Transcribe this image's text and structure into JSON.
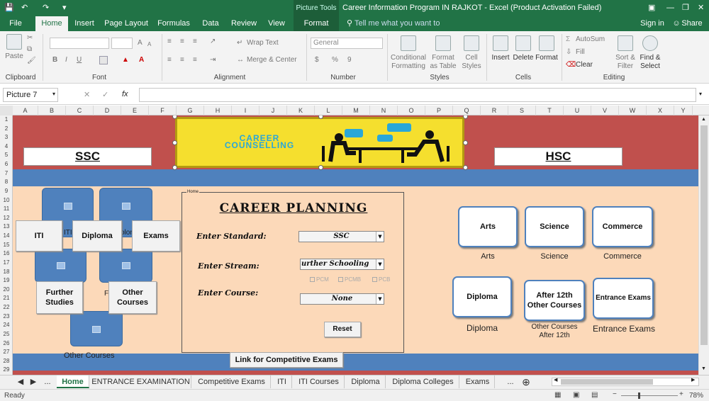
{
  "window": {
    "title": "Career Information Program  IN RAJKOT - Excel (Product Activation Failed)",
    "context_tab_group": "Picture Tools",
    "restore_icon": "restore-icon",
    "sign_in": "Sign in",
    "share": "Share"
  },
  "ribbon_tabs": [
    "File",
    "Home",
    "Insert",
    "Page Layout",
    "Formulas",
    "Data",
    "Review",
    "View",
    "Format"
  ],
  "tell_me": "Tell me what you want to do...",
  "ribbon": {
    "clipboard": {
      "paste": "Paste",
      "label": "Clipboard"
    },
    "font": {
      "label": "Font",
      "bold": "B",
      "italic": "I",
      "underline": "U",
      "grow": "A",
      "shrink": "A"
    },
    "alignment": {
      "wrap": "Wrap Text",
      "merge": "Merge & Center",
      "label": "Alignment"
    },
    "number": {
      "format": "General",
      "currency": "$",
      "percent": "%",
      "comma": "9",
      "label": "Number"
    },
    "styles": {
      "cond": "Conditional Formatting",
      "table": "Format as Table",
      "cell": "Cell Styles",
      "label": "Styles"
    },
    "cells": {
      "insert": "Insert",
      "delete": "Delete",
      "format": "Format",
      "label": "Cells"
    },
    "editing": {
      "autosum": "AutoSum",
      "fill": "Fill",
      "clear": "Clear",
      "sort": "Sort & Filter",
      "find": "Find & Select",
      "label": "Editing"
    }
  },
  "formula_bar": {
    "name_box": "Picture 7",
    "fx": "fx",
    "cancel": "✕",
    "enter": "✓",
    "value": ""
  },
  "columns": [
    "A",
    "B",
    "C",
    "D",
    "E",
    "F",
    "G",
    "H",
    "I",
    "J",
    "K",
    "L",
    "M",
    "N",
    "O",
    "P",
    "Q",
    "R",
    "S",
    "T",
    "U",
    "V",
    "W",
    "X",
    "Y"
  ],
  "rows": [
    "1",
    "2",
    "3",
    "4",
    "5",
    "6",
    "7",
    "8",
    "9",
    "10",
    "11",
    "12",
    "13",
    "14",
    "15",
    "16",
    "17",
    "18",
    "19",
    "20",
    "21",
    "22",
    "23",
    "24",
    "25",
    "26",
    "27",
    "28",
    "29"
  ],
  "sheet": {
    "ssc": "SSC",
    "hsc": "HSC",
    "banner_line1": "CAREER",
    "banner_line2": "COUNSELLING",
    "left_buttons": {
      "iti": "ITI",
      "diploma": "Diploma",
      "exams": "Exams",
      "further_line1": "Further",
      "further_line2": "Studies",
      "other_line1": "Other",
      "other_line2": "Courses",
      "peek_iti": "ITI",
      "peek_diploma": "olon",
      "peek_other": "F",
      "bottom_caption": "Other Courses"
    },
    "form": {
      "group_caption": "Home",
      "title": "CAREER PLANNING",
      "standard_label": "Enter Standard:",
      "standard_value": "SSC",
      "stream_label": "Enter Stream:",
      "stream_value": "urther Schooling",
      "course_label": "Enter Course:",
      "course_value": "None",
      "chk_pcm": "PCM",
      "chk_pcmb": "PCMB",
      "chk_pcb": "PCB",
      "reset": "Reset"
    },
    "link_button": "Link for Competitive Exams",
    "right": {
      "arts": "Arts",
      "science": "Science",
      "commerce": "Commerce",
      "arts_cap": "Arts",
      "science_cap": "Science",
      "commerce_cap": "Commerce",
      "diploma": "Diploma",
      "after12_line1": "After 12th",
      "after12_line2": "Other Courses",
      "entrance": "Entrance Exams",
      "diploma_cap": "Diploma",
      "after12_cap_line1": "Other Courses",
      "after12_cap_line2": "After 12th",
      "entrance_cap": "Entrance Exams"
    }
  },
  "sheet_tabs": [
    "Home",
    "ENTRANCE EXAMINATION",
    "Competitive Exams",
    "ITI",
    "ITI Courses",
    "Diploma",
    "Diploma Colleges",
    "Exams"
  ],
  "tab_nav": {
    "ellipsis": "...",
    "more": "..."
  },
  "status": {
    "ready": "Ready",
    "zoom": "78%"
  },
  "colors": {
    "green": "#217346",
    "red_band": "#c0504d",
    "blue_band": "#4f81bd",
    "peach": "#fcd9b9",
    "banner": "#f5df2e"
  }
}
